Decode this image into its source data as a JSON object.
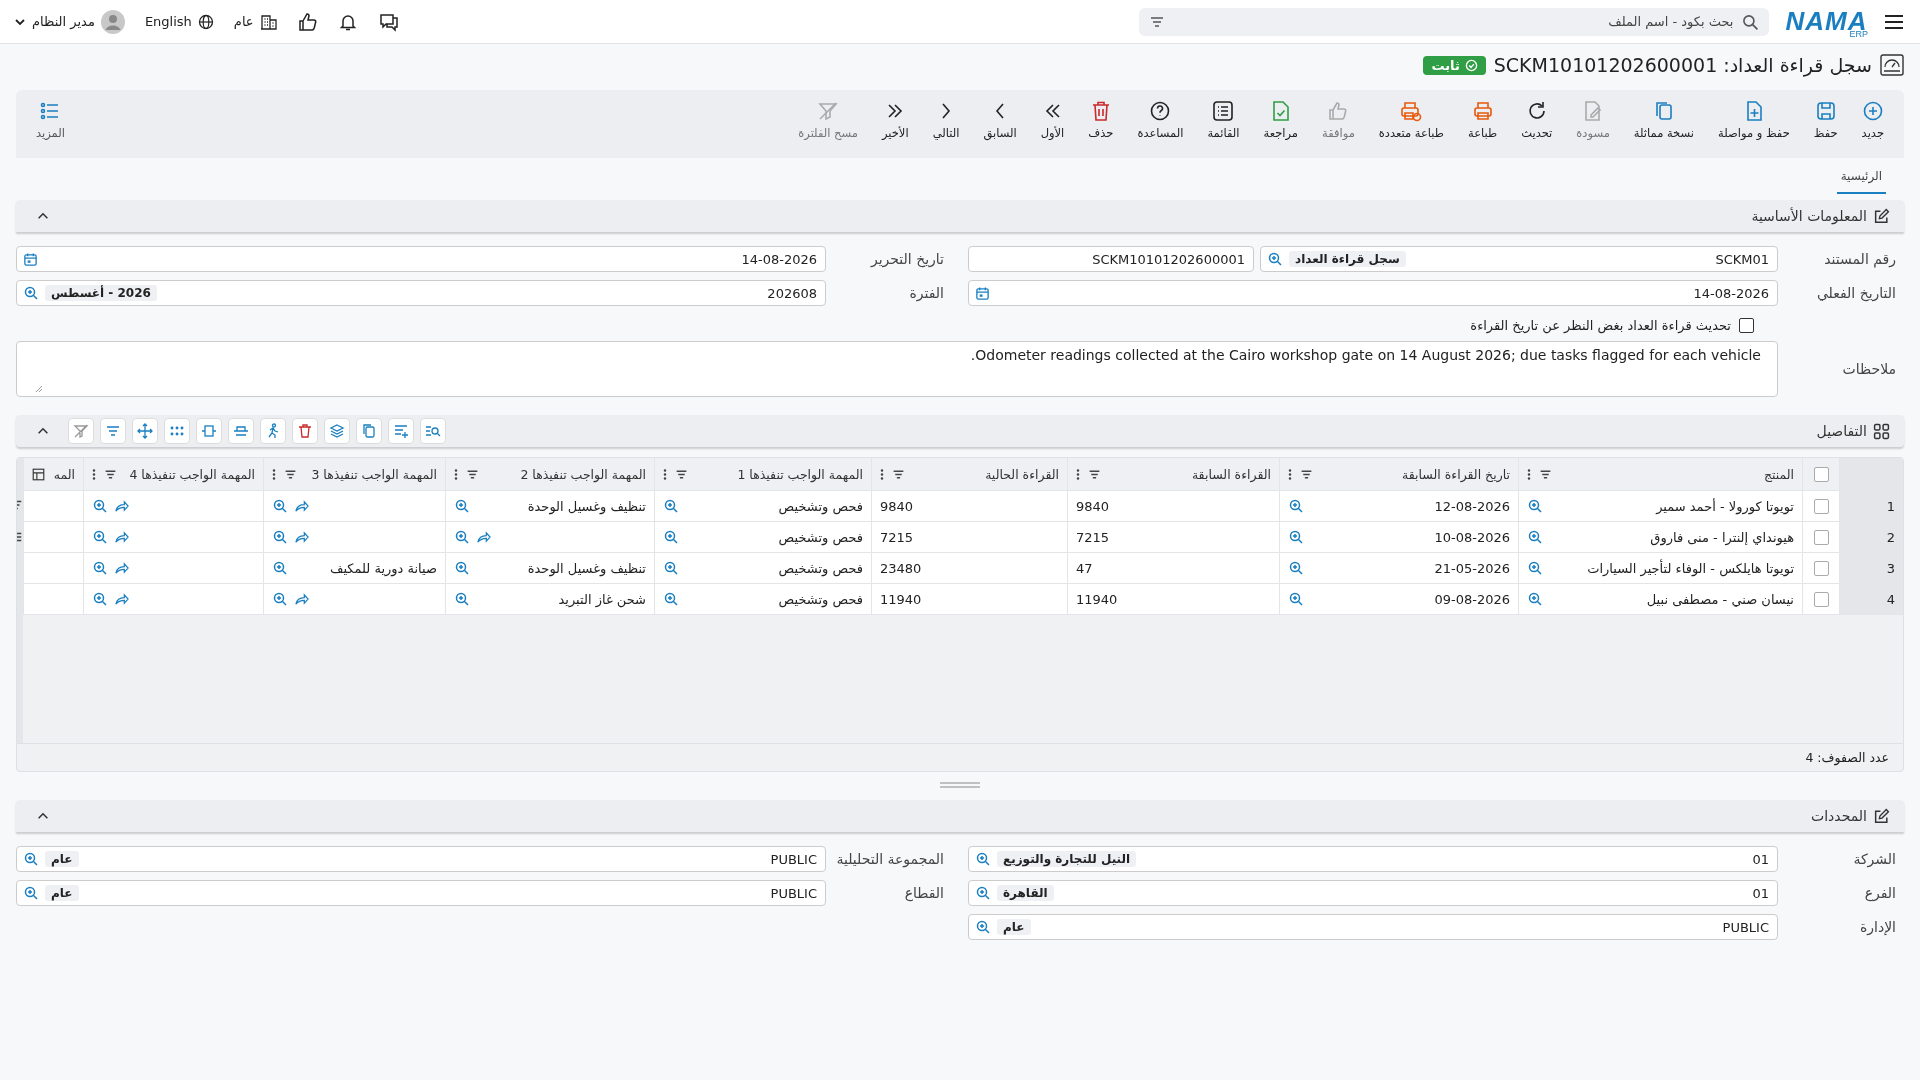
{
  "topbar": {
    "logo": "NAMA",
    "logo_sub": "ERP",
    "search": {
      "placeholder": "بحث بكود - اسم الملف"
    },
    "branch": "عام",
    "language": "English",
    "user": "مدير النظام"
  },
  "title": {
    "text": "سجل قراءة العداد: SCKM10101202600001",
    "status": "ثابت"
  },
  "toolbar": [
    {
      "kind": "new",
      "label": "جديد",
      "disabled": false
    },
    {
      "kind": "save",
      "label": "حفظ",
      "disabled": false
    },
    {
      "kind": "save-continue",
      "label": "حفظ و مواصلة",
      "disabled": false
    },
    {
      "kind": "copy",
      "label": "نسخة مماثلة",
      "disabled": false
    },
    {
      "kind": "draft",
      "label": "مسودة",
      "disabled": true
    },
    {
      "kind": "refresh",
      "label": "تحديث",
      "disabled": false
    },
    {
      "kind": "print",
      "label": "طباعة",
      "disabled": false
    },
    {
      "kind": "multi-print",
      "label": "طباعة متعددة",
      "disabled": false
    },
    {
      "kind": "approve",
      "label": "موافقة",
      "disabled": true
    },
    {
      "kind": "review",
      "label": "مراجعة",
      "disabled": false
    },
    {
      "kind": "list",
      "label": "القائمة",
      "disabled": false
    },
    {
      "kind": "help",
      "label": "المساعدة",
      "disabled": false
    },
    {
      "kind": "delete",
      "label": "حذف",
      "disabled": false
    },
    {
      "kind": "first",
      "label": "الأول",
      "disabled": false
    },
    {
      "kind": "prev",
      "label": "السابق",
      "disabled": false
    },
    {
      "kind": "next",
      "label": "التالي",
      "disabled": false
    },
    {
      "kind": "last",
      "label": "الأخير",
      "disabled": false
    },
    {
      "kind": "clear-filter",
      "label": "مسح الفلترة",
      "disabled": true
    }
  ],
  "more": "المزيد",
  "tabs": [
    {
      "label": "الرئيسية",
      "selected": true
    }
  ],
  "basic": {
    "title": "المعلومات الأساسية",
    "expanded": true,
    "right_fields": [
      {
        "kind": "code",
        "label": "رقم المستند",
        "value": "SCKM01",
        "tag": "سجل قراءة العداد",
        "extra": "SCKM10101202600001"
      },
      {
        "kind": "date",
        "label": "التاريخ الفعلي",
        "value": "14-08-2026"
      }
    ],
    "left_fields": [
      {
        "kind": "date",
        "label": "تاريخ التحرير",
        "value": "14-08-2026"
      },
      {
        "kind": "lookup",
        "label": "الفترة",
        "value": "202608",
        "tag": "2026 - أغسطس"
      }
    ],
    "checkbox": {
      "label": "تحديث قراءة العداد بغض النظر عن تاريخ القراءة",
      "checked": false
    },
    "notes": {
      "label": "ملاحظات",
      "value": "Odometer readings collected at the Cairo workshop gate on 14 August 2026; due tasks flagged for each vehicle."
    }
  },
  "details": {
    "title": "التفاصيل",
    "expanded": true,
    "columns": [
      "المنتج",
      "تاريخ القراءة السابقة",
      "القراءة السابقة",
      "القراءة الحالية",
      "المهمة الواجب تنفيذها 1",
      "المهمة الواجب تنفيذها 2",
      "المهمة الواجب تنفيذها 3",
      "المهمة الواجب تنفيذها 4",
      "المه"
    ],
    "select_all": {
      "checked": false
    },
    "rows": [
      {
        "num": "1",
        "checked": false,
        "product": "تويوتا كورولا - أحمد سمير",
        "date": "12-08-2026",
        "previous": "9840",
        "current": "9840",
        "task_1": "فحص وتشخيص",
        "task_2": "تنظيف وغسيل الوحدة"
      },
      {
        "num": "2",
        "checked": false,
        "product": "هيونداي إلنترا - منى فاروق",
        "date": "10-08-2026",
        "previous": "7215",
        "current": "7215",
        "task_1": "فحص وتشخيص"
      },
      {
        "num": "3",
        "checked": false,
        "product": "تويوتا هايلكس - الوفاء لتأجير السيارات",
        "date": "21-05-2026",
        "previous": "47",
        "current": "23480",
        "task_1": "فحص وتشخيص",
        "task_2": "تنظيف وغسيل الوحدة",
        "task_3": "صيانة دورية للمكيف"
      },
      {
        "num": "4",
        "checked": false,
        "product": "نيسان صني - مصطفى نبيل",
        "date": "09-08-2026",
        "previous": "11940",
        "current": "11940",
        "task_1": "فحص وتشخيص",
        "task_2": "شحن غاز التبريد"
      }
    ],
    "row_count": "عدد الصفوف: 4"
  },
  "determinants": {
    "title": "المحددات",
    "expanded": true,
    "right_fields": [
      {
        "kind": "lookup",
        "label": "الشركة",
        "value": "01",
        "tag": "النيل للتجارة والتوزيع"
      },
      {
        "kind": "lookup",
        "label": "الفرع",
        "value": "01",
        "tag": "القاهرة"
      },
      {
        "kind": "lookup",
        "label": "الإدارة",
        "value": "PUBLIC",
        "tag": "عام"
      }
    ],
    "left_fields": [
      {
        "kind": "lookup",
        "label": "المجموعة التحليلية",
        "value": "PUBLIC",
        "tag": "عام"
      },
      {
        "kind": "lookup",
        "label": "القطاع",
        "value": "PUBLIC",
        "tag": "عام"
      }
    ]
  }
}
